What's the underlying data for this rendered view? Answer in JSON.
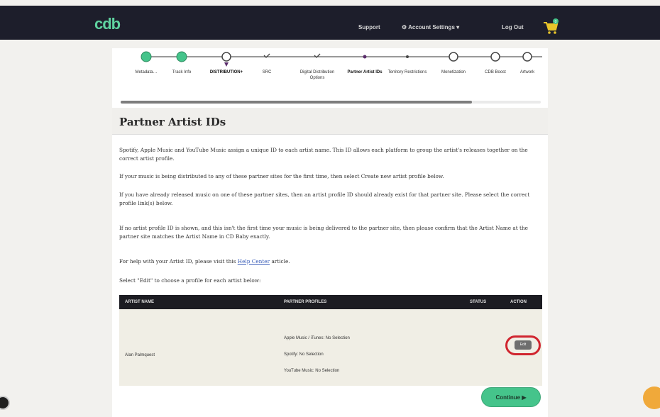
{
  "header": {
    "logo": "cdb",
    "support": "Support",
    "account_settings": "Account Settings",
    "logout": "Log Out",
    "cart_count": "0"
  },
  "stepper": {
    "steps": [
      {
        "label": "Metadata…",
        "state": "done"
      },
      {
        "label": "Track Info",
        "state": "done"
      },
      {
        "label": "DISTRIBUTION+",
        "state": "current"
      },
      {
        "label": "SRC",
        "state": "checked"
      },
      {
        "label": "Digital Distribution Options",
        "state": "checked"
      },
      {
        "label": "Partner Artist IDs",
        "state": "active"
      },
      {
        "label": "Territory Restrictions",
        "state": "dot"
      },
      {
        "label": "Monetization",
        "state": "empty"
      },
      {
        "label": "CDB Boost",
        "state": "empty"
      },
      {
        "label": "Artwork",
        "state": "empty"
      }
    ]
  },
  "page": {
    "title": "Partner Artist IDs",
    "paragraphs": [
      "Spotify, Apple Music and YouTube Music assign a unique ID to each artist name. This ID allows each platform to group the artist's releases together on the correct artist profile.",
      "If your music is being distributed to any of these partner sites for the first time, then select Create new artist profile below.",
      "If you have already released music on one of these partner sites, then an artist profile ID should already exist for that partner site. Please select the correct profile link(s) below.",
      "If no artist profile ID is shown, and this isn't the first time your music is being delivered to the partner site, then please confirm that the Artist Name at the partner site matches the Artist Name in CD Baby exactly."
    ],
    "help_prefix": "For help with your Artist ID, please visit this ",
    "help_link": "Help Center",
    "help_suffix": " article.",
    "select_instruction": "Select \"Edit\" to choose a profile for each artist below:"
  },
  "table": {
    "headers": {
      "artist_name": "ARTIST NAME",
      "partner_profiles": "PARTNER PROFILES",
      "status": "STATUS",
      "action": "ACTION"
    },
    "rows": [
      {
        "artist_name": "Alan Palmquest",
        "profiles": [
          "Apple Music / iTunes: No Selection",
          "Spotify: No Selection",
          "YouTube Music: No Selection"
        ],
        "action_label": "Edit"
      }
    ]
  },
  "footer": {
    "continue_label": "Continue ▶"
  },
  "colors": {
    "topbar": "#1d1e2b",
    "brand_green": "#45c48b",
    "highlight_red": "#d0252f",
    "cart_yellow": "#e8c52a"
  }
}
